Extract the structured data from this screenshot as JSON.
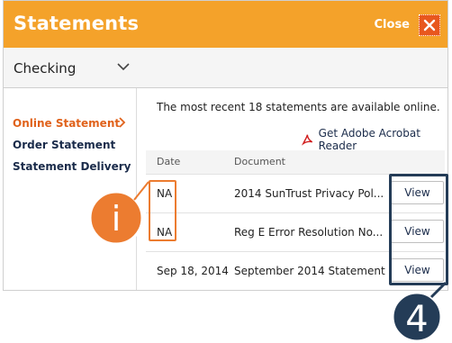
{
  "header": {
    "title": "Statements",
    "close_label": "Close"
  },
  "account": {
    "selected": "Checking"
  },
  "sidebar": {
    "items": [
      {
        "label": "Online Statement",
        "active": true
      },
      {
        "label": "Order Statement",
        "active": false
      },
      {
        "label": "Statement Delivery",
        "active": false
      }
    ]
  },
  "content": {
    "intro": "The most recent 18 statements are available online.",
    "acrobat_link": "Get Adobe Acrobat Reader",
    "table": {
      "headers": [
        "Date",
        "Document"
      ],
      "rows": [
        {
          "date": "NA",
          "document": "2014 SunTrust Privacy Pol...",
          "action": "View"
        },
        {
          "date": "NA",
          "document": "Reg E Error Resolution No...",
          "action": "View"
        },
        {
          "date": "Sep 18, 2014",
          "document": "September 2014 Statement",
          "action": "View"
        }
      ]
    }
  },
  "annotations": {
    "callout_info": "i",
    "callout_step": "4"
  },
  "colors": {
    "header": "#f4a22a",
    "close_button": "#e8571e",
    "active_link": "#e0621b",
    "link_navy": "#1a2b4a",
    "highlight_orange": "#ec7c30",
    "highlight_navy": "#243c57"
  }
}
